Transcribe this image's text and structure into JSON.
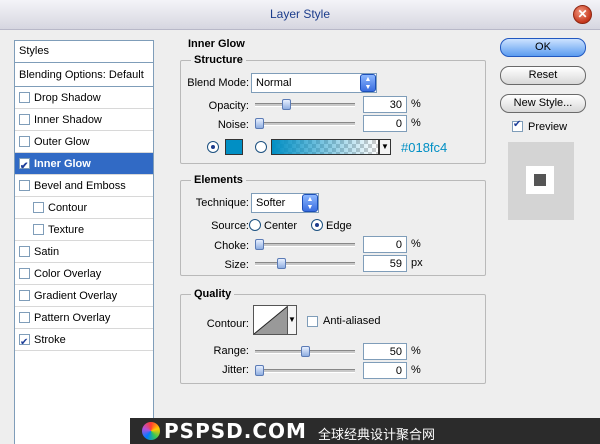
{
  "window": {
    "title": "Layer Style"
  },
  "styles_list": {
    "header": "Styles",
    "blending": "Blending Options: Default",
    "items": [
      {
        "label": "Drop Shadow",
        "checked": false,
        "sub": false,
        "selected": false
      },
      {
        "label": "Inner Shadow",
        "checked": false,
        "sub": false,
        "selected": false
      },
      {
        "label": "Outer Glow",
        "checked": false,
        "sub": false,
        "selected": false
      },
      {
        "label": "Inner Glow",
        "checked": true,
        "sub": false,
        "selected": true
      },
      {
        "label": "Bevel and Emboss",
        "checked": false,
        "sub": false,
        "selected": false
      },
      {
        "label": "Contour",
        "checked": false,
        "sub": true,
        "selected": false
      },
      {
        "label": "Texture",
        "checked": false,
        "sub": true,
        "selected": false
      },
      {
        "label": "Satin",
        "checked": false,
        "sub": false,
        "selected": false
      },
      {
        "label": "Color Overlay",
        "checked": false,
        "sub": false,
        "selected": false
      },
      {
        "label": "Gradient Overlay",
        "checked": false,
        "sub": false,
        "selected": false
      },
      {
        "label": "Pattern Overlay",
        "checked": false,
        "sub": false,
        "selected": false
      },
      {
        "label": "Stroke",
        "checked": true,
        "sub": false,
        "selected": false
      }
    ]
  },
  "inner_glow": {
    "title": "Inner Glow",
    "structure": {
      "legend": "Structure",
      "blend_mode_label": "Blend Mode:",
      "blend_mode_value": "Normal",
      "opacity_label": "Opacity:",
      "opacity_value": "30",
      "opacity_fraction": 0.3,
      "noise_label": "Noise:",
      "noise_value": "0",
      "noise_fraction": 0.0,
      "percent": "%",
      "color_hex_label": "#018fc4",
      "glow_color": "#018fc4"
    },
    "elements": {
      "legend": "Elements",
      "technique_label": "Technique:",
      "technique_value": "Softer",
      "source_label": "Source:",
      "source_center": "Center",
      "source_edge": "Edge",
      "choke_label": "Choke:",
      "choke_value": "0",
      "choke_fraction": 0.0,
      "size_label": "Size:",
      "size_value": "59",
      "size_fraction": 0.24,
      "percent": "%",
      "px": "px"
    },
    "quality": {
      "legend": "Quality",
      "contour_label": "Contour:",
      "anti_aliased_label": "Anti-aliased",
      "range_label": "Range:",
      "range_value": "50",
      "range_fraction": 0.5,
      "jitter_label": "Jitter:",
      "jitter_value": "0",
      "jitter_fraction": 0.0,
      "percent": "%"
    }
  },
  "buttons": {
    "ok": "OK",
    "reset": "Reset",
    "new_style": "New Style...",
    "preview_label": "Preview"
  },
  "watermark": {
    "brand": "PSPSD.COM",
    "tagline": "全球经典设计聚合网"
  }
}
